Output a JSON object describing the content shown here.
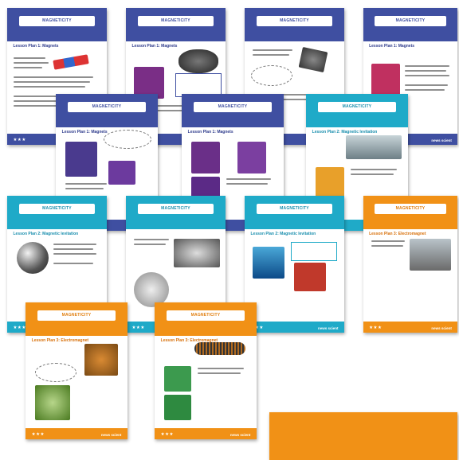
{
  "magazine_title": "MAGNETICITY",
  "brand": "news scient",
  "stars": "★★★",
  "colors": {
    "blue": "#3f4fa1",
    "teal": "#1faac8",
    "orange": "#f19116"
  },
  "pages": [
    {
      "heading": "Lesson Plan 1: Magnets",
      "theme": "blue"
    },
    {
      "heading": "Lesson Plan 1: Magnets",
      "theme": "blue"
    },
    {
      "heading": "",
      "theme": "blue"
    },
    {
      "heading": "Lesson Plan 1: Magnets",
      "theme": "blue"
    },
    {
      "heading": "Lesson Plan 1: Magnets",
      "theme": "blue"
    },
    {
      "heading": "Lesson Plan 1: Magnets",
      "theme": "blue"
    },
    {
      "heading": "Lesson Plan 2: Magnetic levitation",
      "theme": "teal"
    },
    {
      "heading": "Lesson Plan 2: Magnetic levitation",
      "theme": "teal"
    },
    {
      "heading": "Lesson Plan 2: Magnetic levitation",
      "theme": "teal"
    },
    {
      "heading": "Lesson Plan 2: Magnetic levitation",
      "theme": "teal"
    },
    {
      "heading": "Lesson Plan 3: Electromagnet",
      "theme": "orange"
    },
    {
      "heading": "Lesson Plan 3: Electromagnet",
      "theme": "orange"
    },
    {
      "heading": "Lesson Plan 3: Electromagnet",
      "theme": "orange"
    },
    {
      "heading": "",
      "theme": "orange"
    }
  ]
}
